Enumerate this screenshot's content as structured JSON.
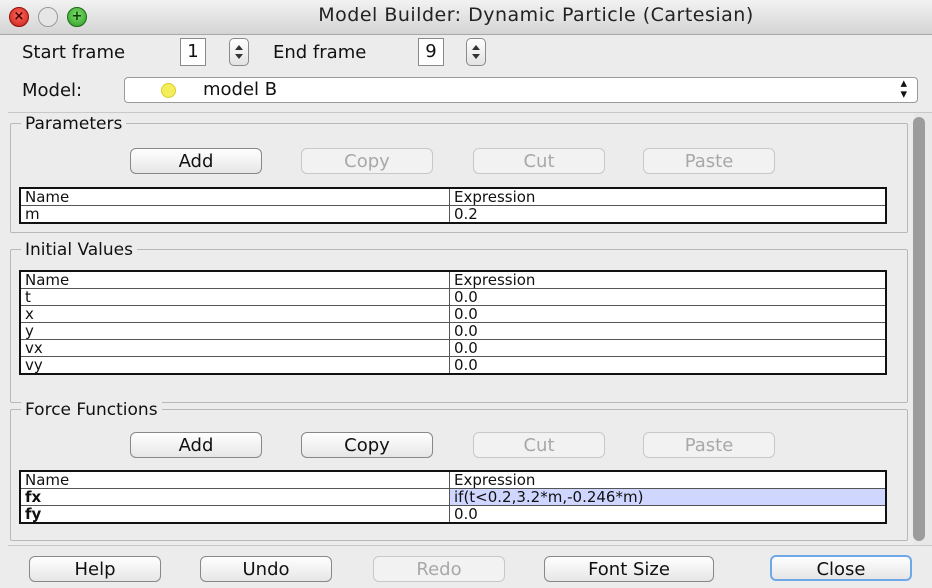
{
  "window": {
    "title": "Model Builder: Dynamic Particle (Cartesian)"
  },
  "frames": {
    "start_label": "Start frame",
    "start_value": "1",
    "end_label": "End frame",
    "end_value": "9"
  },
  "model": {
    "label": "Model:",
    "value": "model B"
  },
  "parameters": {
    "title": "Parameters",
    "buttons": {
      "add": "Add",
      "copy": "Copy",
      "cut": "Cut",
      "paste": "Paste"
    },
    "columns": [
      "Name",
      "Expression"
    ],
    "rows": [
      {
        "name": "m",
        "expr": "0.2"
      }
    ]
  },
  "initial_values": {
    "title": "Initial Values",
    "columns": [
      "Name",
      "Expression"
    ],
    "rows": [
      {
        "name": "t",
        "expr": "0.0"
      },
      {
        "name": "x",
        "expr": "0.0"
      },
      {
        "name": "y",
        "expr": "0.0"
      },
      {
        "name": "vx",
        "expr": "0.0"
      },
      {
        "name": "vy",
        "expr": "0.0"
      }
    ]
  },
  "force_functions": {
    "title": "Force Functions",
    "buttons": {
      "add": "Add",
      "copy": "Copy",
      "cut": "Cut",
      "paste": "Paste"
    },
    "columns": [
      "Name",
      "Expression"
    ],
    "rows": [
      {
        "name": "fx",
        "expr": "if(t<0.2,3.2*m,-0.246*m)"
      },
      {
        "name": "fy",
        "expr": "0.0"
      }
    ]
  },
  "footer": {
    "help": "Help",
    "undo": "Undo",
    "redo": "Redo",
    "font_size": "Font Size",
    "close": "Close"
  },
  "colors": {
    "selected_row": "#cfd6ff",
    "default_button_border": "#6fa8e8",
    "model_dot": "#f4ee5a"
  }
}
